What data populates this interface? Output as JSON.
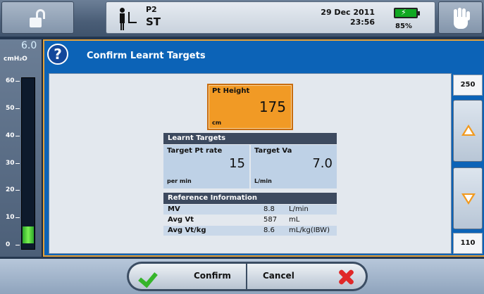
{
  "status_bar": {
    "lock_icon": "unlocked-padlock-icon",
    "patient_icon": "patient-category-icon",
    "mode_code": "P2",
    "mode_name": "ST",
    "date": "29 Dec 2011",
    "time": "23:56",
    "battery_percent": "85%",
    "battery_level": 0.85,
    "hand_icon": "alarm-silence-hand-icon"
  },
  "gauge": {
    "value": "6.0",
    "unit": "cmH₂O",
    "ticks": [
      "60",
      "50",
      "40",
      "30",
      "20",
      "10",
      "0"
    ],
    "fill_level": 0.1,
    "fill_color": "#2da928"
  },
  "dialog": {
    "title": "Confirm Learnt Targets",
    "help_icon": "question-icon",
    "pt_height": {
      "label": "Pt Height",
      "value": "175",
      "unit": "cm",
      "color": "#f19a25"
    },
    "learnt_targets": {
      "header": "Learnt Targets",
      "items": [
        {
          "label": "Target Pt rate",
          "value": "15",
          "unit": "per min"
        },
        {
          "label": "Target Va",
          "value": "7.0",
          "unit": "L/min"
        }
      ]
    },
    "reference": {
      "header": "Reference Information",
      "rows": [
        {
          "name": "MV",
          "value": "8.8",
          "unit": "L/min"
        },
        {
          "name": "Avg Vt",
          "value": "587",
          "unit": "mL"
        },
        {
          "name": "Avg Vt/kg",
          "value": "8.6",
          "unit": "mL/kg(IBW)"
        }
      ]
    },
    "adjust": {
      "max": "250",
      "min": "110"
    }
  },
  "footer": {
    "confirm_label": "Confirm",
    "cancel_label": "Cancel"
  }
}
